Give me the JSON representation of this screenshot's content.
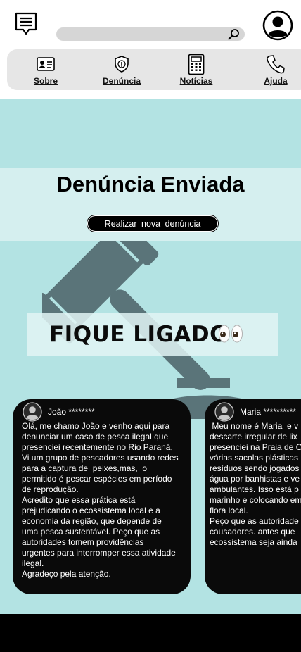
{
  "header": {
    "search": {
      "value": "",
      "placeholder": ""
    }
  },
  "nav": {
    "items": [
      {
        "label": "Sobre",
        "icon": "id-card-icon"
      },
      {
        "label": "Denúncia",
        "icon": "shield-alert-icon"
      },
      {
        "label": "Notícias",
        "icon": "calculator-news-icon"
      },
      {
        "label": "Ajuda",
        "icon": "phone-icon"
      }
    ]
  },
  "banner": {
    "title": "Denúncia Enviada",
    "button_label": "Realizar nova denúncia"
  },
  "fique": {
    "title": "FIQUE LIGADO",
    "emoji": "👀"
  },
  "comments": [
    {
      "name": "João ********",
      "text": "Olá, me chamo João e venho aqui para\ndenunciar um caso de pesca ilegal que\npresenciei recentemente no Rio Paraná,\nVi um grupo de pescadores usando redes\npara a captura de  peixes,mas,  o\npermitido é pescar espécies em período\nde reprodução.\nAcredito que essa prática está\nprejudicando o ecossistema local e a\neconomia da região, que depende de\numa pesca sustentável. Peço que as\nautoridades tomem providências\nurgentes para interromper essa atividade\nilegal.\nAgradeço pela atenção."
    },
    {
      "name": "Maria **********",
      "text": " Meu nome é Maria  e v\ndescarte irregular de lix\npresenciei na Praia de C\nvárias sacolas plásticas\nresíduos sendo jogados\nágua por banhistas e ve\nambulantes. Isso está p\nmarinho e colocando em\nflora local.\nPeço que as autoridade\ncausadores. antes que \necossistema seja ainda"
    }
  ],
  "colors": {
    "main_bg": "#b3e3e3",
    "banner_bg": "#d5efef",
    "nav_bg": "#e6e6e6",
    "card_bg": "#0a0a0a",
    "watermark": "#5a7479"
  }
}
